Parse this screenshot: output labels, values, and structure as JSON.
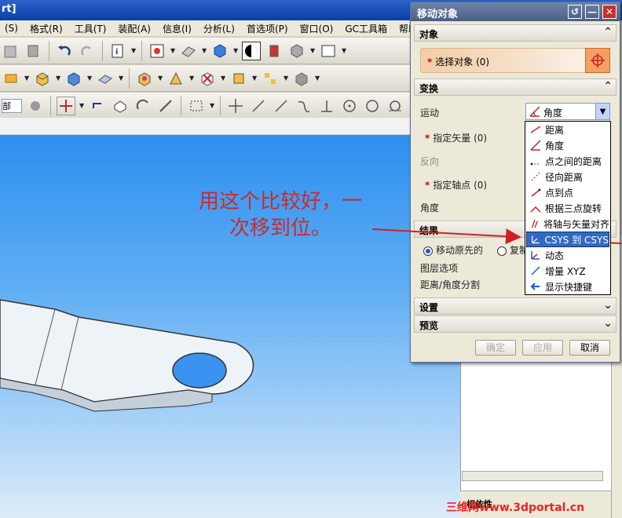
{
  "window": {
    "title": "rt]"
  },
  "menu": [
    "(S)",
    "格式(R)",
    "工具(T)",
    "装配(A)",
    "信息(I)",
    "分析(L)",
    "首选项(P)",
    "窗口(O)",
    "GC工具箱",
    "帮助"
  ],
  "toolbar3": {
    "layer_combo": "部"
  },
  "annotation": {
    "line1": "用这个比较好，一",
    "line2": "次移到位。"
  },
  "side_footer": "相依性",
  "watermark": "三维网www.3dportal.cn",
  "dialog": {
    "title": "移动对象",
    "object_section": "对象",
    "select_object": "选择对象 (0)",
    "transform_section": "变换",
    "motion_label": "运动",
    "motion_value": "角度",
    "specify_vector": "指定矢量 (0)",
    "reverse": "反向",
    "specify_pivot": "指定轴点 (0)",
    "angle_label": "角度",
    "result_section": "结果",
    "move_original": "移动原先的",
    "copy_original": "复制",
    "layer_option": "图层选项",
    "distance_angle_split": "距离/角度分割",
    "settings_section": "设置",
    "preview_section": "预览",
    "ok": "确定",
    "apply": "应用",
    "cancel": "取消"
  },
  "motion_options": [
    {
      "label": "距离",
      "icon": "distance-icon"
    },
    {
      "label": "角度",
      "icon": "angle-icon"
    },
    {
      "label": "点之间的距离",
      "icon": "point-distance-icon"
    },
    {
      "label": "径向距离",
      "icon": "radial-distance-icon"
    },
    {
      "label": "点到点",
      "icon": "point-to-point-icon"
    },
    {
      "label": "根据三点旋转",
      "icon": "three-point-rotate-icon"
    },
    {
      "label": "将轴与矢量对齐",
      "icon": "align-axis-icon"
    },
    {
      "label": "CSYS 到 CSYS",
      "icon": "csys-icon",
      "selected": true
    },
    {
      "label": "动态",
      "icon": "dynamic-icon"
    },
    {
      "label": "增量 XYZ",
      "icon": "delta-xyz-icon"
    },
    {
      "label": "显示快捷键",
      "icon": "shortcut-icon"
    }
  ],
  "colors": {
    "annotation": "#cc2a2a",
    "selection": "#316ac5",
    "viewport_top": "#2e8ff0"
  }
}
